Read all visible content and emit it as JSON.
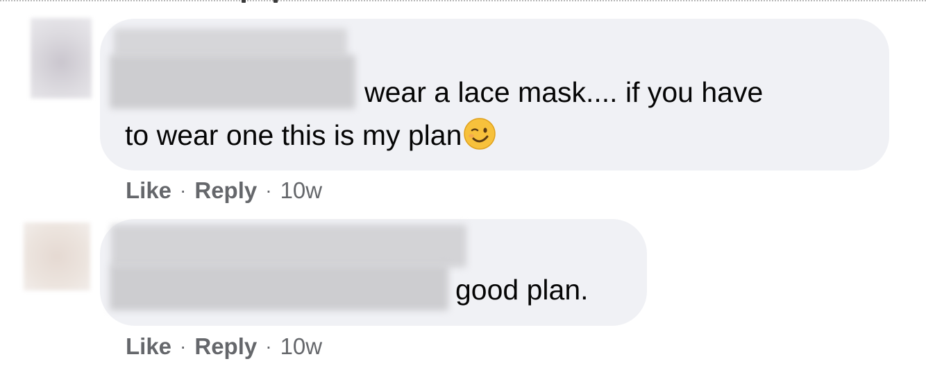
{
  "comments": [
    {
      "text_line1": "wear a lace mask.... if you have",
      "text_line2": "to wear one this is my plan",
      "emoji": "winking-face-icon",
      "actions": {
        "like": "Like",
        "separator": "·",
        "reply": "Reply",
        "time": "10w"
      }
    },
    {
      "text_line1": "good plan.",
      "actions": {
        "like": "Like",
        "separator": "·",
        "reply": "Reply",
        "time": "10w"
      }
    }
  ],
  "colors": {
    "bubble_background": "#f0f1f5",
    "text": "#050505",
    "secondary_text": "#65676b",
    "emoji_face": "#f7c13c"
  }
}
